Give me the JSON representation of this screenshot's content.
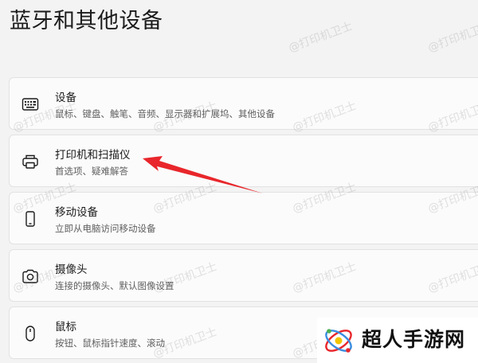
{
  "page": {
    "title": "蓝牙和其他设备"
  },
  "items": [
    {
      "label": "设备",
      "desc": "鼠标、键盘、触笔、音频、显示器和扩展坞、其他设备",
      "icon": "keyboard-icon"
    },
    {
      "label": "打印机和扫描仪",
      "desc": "首选项、疑难解答",
      "icon": "printer-icon"
    },
    {
      "label": "移动设备",
      "desc": "立即从电脑访问移动设备",
      "icon": "phone-icon"
    },
    {
      "label": "摄像头",
      "desc": "连接的摄像头、默认图像设置",
      "icon": "camera-icon"
    },
    {
      "label": "鼠标",
      "desc": "按钮、鼠标指针速度、滚动",
      "icon": "mouse-icon"
    }
  ],
  "watermark": {
    "text": "@打印机卫士"
  },
  "annotation": {
    "arrow_color": "#e8262b",
    "icon": "red-arrow-icon"
  },
  "brand": {
    "text": "超人手游网",
    "icon": "brand-logo-icon"
  }
}
